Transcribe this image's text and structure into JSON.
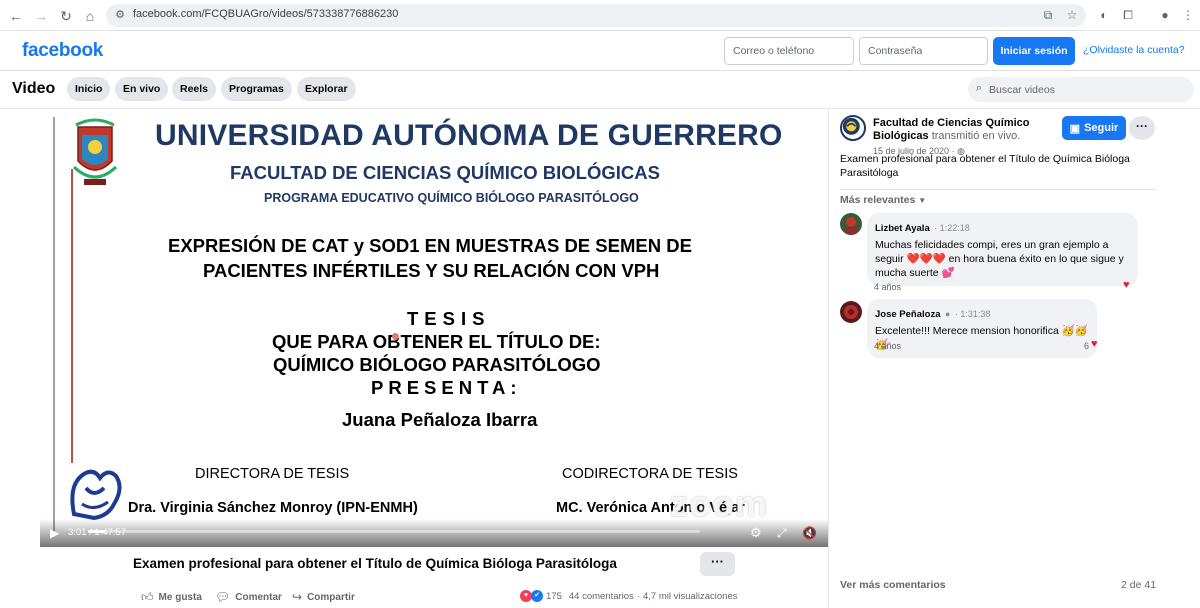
{
  "browser": {
    "url": "facebook.com/FCQBUAGro/videos/573338776886230",
    "back_icon": "arrow-left",
    "forward_icon": "arrow-right",
    "reload_icon": "reload",
    "home_icon": "home"
  },
  "header": {
    "logo": "facebook",
    "email_placeholder": "Correo o teléfono",
    "password_placeholder": "Contraseña",
    "login_label": "Iniciar sesión",
    "forgot_label": "¿Olvidaste la cuenta?"
  },
  "video_nav": {
    "title": "Video",
    "tabs": [
      {
        "label": "Inicio"
      },
      {
        "label": "En vivo"
      },
      {
        "label": "Reels"
      },
      {
        "label": "Programas"
      },
      {
        "label": "Explorar"
      }
    ],
    "search_placeholder": "Buscar videos"
  },
  "slide": {
    "university": "UNIVERSIDAD AUTÓNOMA DE GUERRERO",
    "faculty": "FACULTAD DE CIENCIAS QUÍMICO BIOLÓGICAS",
    "program": "PROGRAMA EDUCATIVO QUÍMICO BIÓLOGO PARASITÓLOGO",
    "thesis_line1": "EXPRESIÓN DE CAT y SOD1 EN MUESTRAS DE SEMEN DE",
    "thesis_line2": "PACIENTES INFÉRTILES Y SU RELACIÓN CON VPH",
    "tesis": "TESIS",
    "que_para": "QUE PARA OBTENER EL TÍTULO DE:",
    "degree": "QUÍMICO BIÓLOGO PARASITÓLOGO",
    "presenta": "PRESENTA:",
    "student": "Juana Peñaloza Ibarra",
    "director_label": "DIRECTORA DE TESIS",
    "codirector_label": "CODIRECTORA DE TESIS",
    "director": "Dra. Virginia Sánchez Monroy (IPN-ENMH)",
    "codirector": "MC. Verónica Antonio Véjar",
    "watermark": "zoom"
  },
  "player": {
    "time": "3:01 / 1:47:57",
    "progress": 0.028
  },
  "post": {
    "title": "Examen profesional para obtener el Título de Química Bióloga Parasitóloga",
    "more": "···",
    "like_label": "Me gusta",
    "comment_label": "Comentar",
    "share_label": "Compartir",
    "reactions_count": "175",
    "comments_count": "44 comentarios",
    "views": "4,7 mil visualizaciones"
  },
  "sidebar": {
    "page_name": "Facultad de Ciencias Químico Biológicas",
    "page_suffix": "transmitió en vivo.",
    "date": "15 de julio de 2020 ·",
    "follow_label": "Seguir",
    "more": "···",
    "description": "Examen profesional para obtener el Título de Química Bióloga Parasitóloga",
    "sort_label": "Más relevantes",
    "comments": [
      {
        "name": "Lizbet Ayala",
        "timestamp": "· 1:22:18",
        "text": "Muchas felicidades compi, eres un gran ejemplo a seguir ❤️❤️❤️ en hora buena éxito en lo que sigue y mucha suerte 💕",
        "age": "4 años",
        "reactions": ""
      },
      {
        "name": "Jose Peñaloza",
        "timestamp": "· 1:31:38",
        "text": "Excelente!!! Merece mension honorifica 🥳🥳🥳",
        "age": "4 años",
        "reactions": "6"
      }
    ],
    "see_more": "Ver más comentarios",
    "pager": "2 de 41"
  },
  "colors": {
    "brand": "#1877f2",
    "slide_navy": "#1f3864",
    "heart": "#e41e3f"
  }
}
